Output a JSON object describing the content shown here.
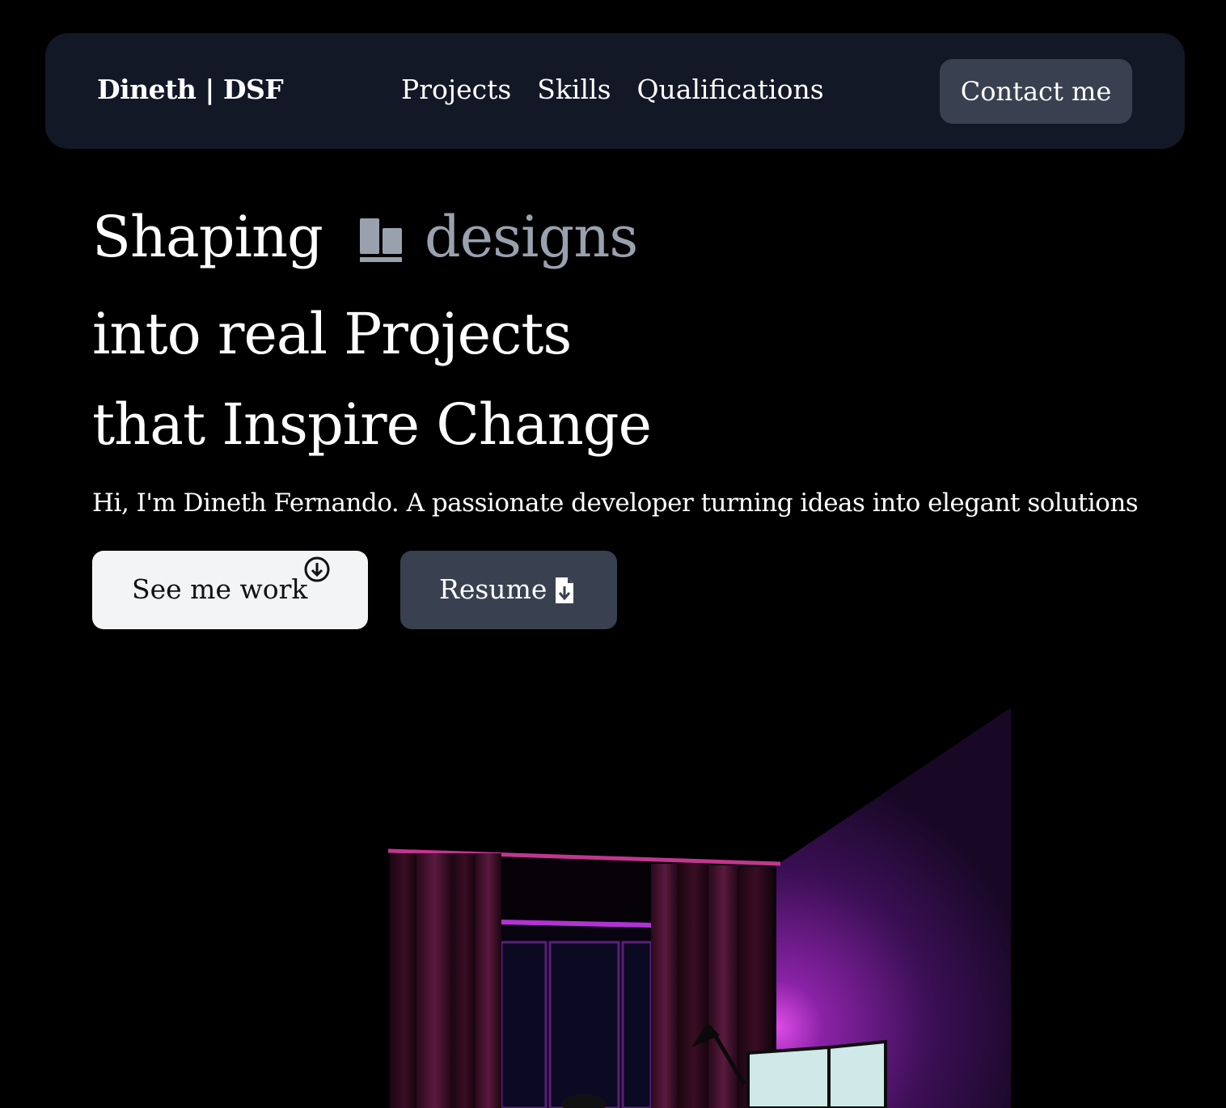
{
  "nav": {
    "brand": "Dineth | DSF",
    "links": [
      "Projects",
      "Skills",
      "Qualifications"
    ],
    "contact_label": "Contact me"
  },
  "hero": {
    "line1_text": "Shaping",
    "rotating_icon": "design-tool-icon",
    "rotating_word": "designs",
    "line2": "into real Projects",
    "line3": "that Inspire Change",
    "subtitle": "Hi, I'm Dineth Fernando. A passionate developer turning ideas into elegant solutions"
  },
  "buttons": {
    "primary_label": "See me work",
    "primary_icon": "arrow-down-circle-icon",
    "secondary_label": "Resume",
    "secondary_icon": "file-download-icon"
  },
  "scene": {
    "description_icon": "room-3d-illustration"
  },
  "colors": {
    "background": "#000000",
    "navbar": "#131826",
    "button_dark": "#394150",
    "button_light": "#f3f4f6",
    "muted_text": "#9aa1ae",
    "accent_glow": "#c02bd6"
  }
}
